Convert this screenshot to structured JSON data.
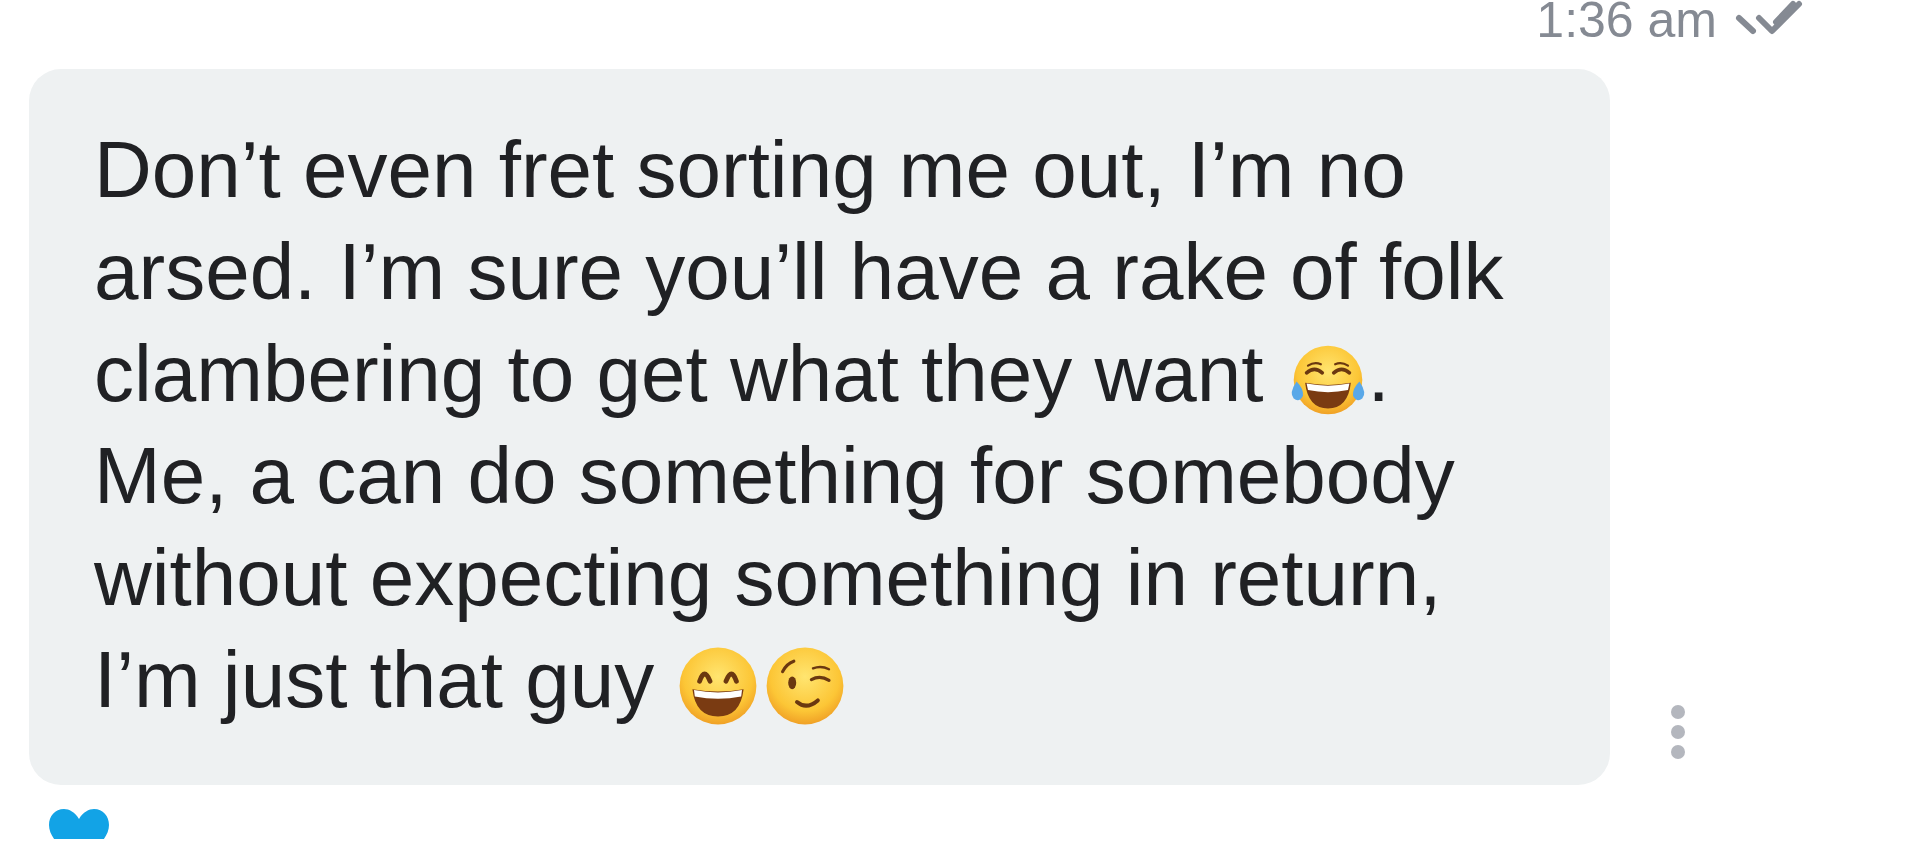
{
  "timestamp": {
    "text": "1:36 am",
    "read": true
  },
  "message": {
    "lines": [
      {
        "parts": [
          {
            "kind": "text",
            "text": "Don’t even fret sorting me out, I’m no"
          }
        ]
      },
      {
        "parts": [
          {
            "kind": "text",
            "text": "arsed. I’m sure you’ll have a rake of folk"
          }
        ]
      },
      {
        "parts": [
          {
            "kind": "text",
            "text": "clambering to get what they want"
          },
          {
            "kind": "joy"
          },
          {
            "kind": "text",
            "text": "."
          }
        ]
      },
      {
        "parts": [
          {
            "kind": "text",
            "text": "Me, a can do something for somebody"
          }
        ]
      },
      {
        "parts": [
          {
            "kind": "text",
            "text": "without expecting something in return,"
          }
        ]
      },
      {
        "parts": [
          {
            "kind": "text",
            "text": "I’m just that guy"
          },
          {
            "kind": "grin"
          },
          {
            "kind": "wink"
          }
        ]
      }
    ]
  },
  "reaction": {
    "liked": true
  }
}
